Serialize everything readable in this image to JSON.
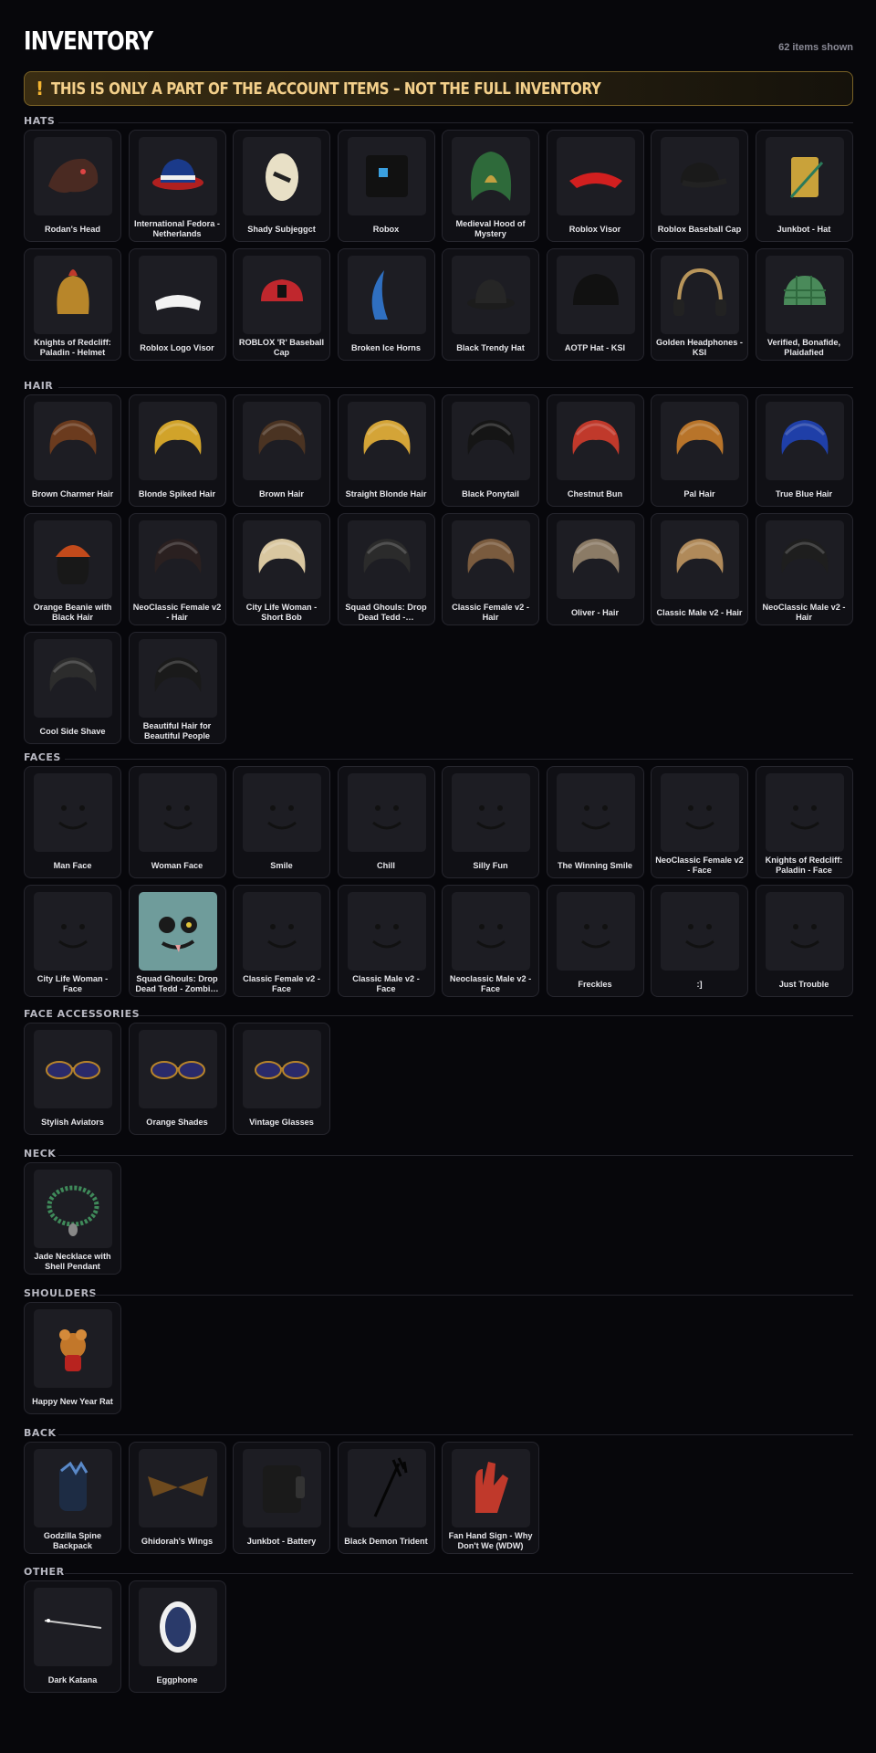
{
  "header": {
    "title": "INVENTORY",
    "count": "62 items shown"
  },
  "banner": {
    "icon": "warning-icon",
    "text": "THIS IS ONLY A PART OF THE ACCOUNT ITEMS – NOT THE FULL INVENTORY"
  },
  "sections": [
    {
      "label": "HATS",
      "items": [
        {
          "name": "Rodan's Head",
          "icon": "dragon-head-icon"
        },
        {
          "name": "International Fedora - Netherlands",
          "icon": "fedora-icon"
        },
        {
          "name": "Shady Subjeggct",
          "icon": "egg-icon"
        },
        {
          "name": "Robox",
          "icon": "robox-icon"
        },
        {
          "name": "Medieval Hood of Mystery",
          "icon": "hood-icon"
        },
        {
          "name": "Roblox Visor",
          "icon": "visor-icon"
        },
        {
          "name": "Roblox Baseball Cap",
          "icon": "cap-icon"
        },
        {
          "name": "Junkbot - Hat",
          "icon": "junkbot-hat-icon"
        },
        {
          "name": "Knights of Redcliff: Paladin - Helmet",
          "icon": "helmet-icon"
        },
        {
          "name": "Roblox Logo Visor",
          "icon": "logo-visor-icon"
        },
        {
          "name": "ROBLOX 'R' Baseball Cap",
          "icon": "r-cap-icon"
        },
        {
          "name": "Broken Ice Horns",
          "icon": "horns-icon"
        },
        {
          "name": "Black Trendy Hat",
          "icon": "trendy-hat-icon"
        },
        {
          "name": "AOTP Hat - KSI",
          "icon": "aotp-hat-icon"
        },
        {
          "name": "Golden Headphones - KSI",
          "icon": "headphones-icon"
        },
        {
          "name": "Verified, Bonafide, Plaidafied",
          "icon": "plaid-hat-icon"
        }
      ]
    },
    {
      "label": "HAIR",
      "items": [
        {
          "name": "Brown Charmer Hair",
          "icon": "hair-icon"
        },
        {
          "name": "Blonde Spiked Hair",
          "icon": "hair-icon"
        },
        {
          "name": "Brown Hair",
          "icon": "hair-icon"
        },
        {
          "name": "Straight Blonde Hair",
          "icon": "hair-icon"
        },
        {
          "name": "Black Ponytail",
          "icon": "hair-icon"
        },
        {
          "name": "Chestnut Bun",
          "icon": "hair-icon"
        },
        {
          "name": "Pal Hair",
          "icon": "hair-icon"
        },
        {
          "name": "True Blue Hair",
          "icon": "hair-icon"
        },
        {
          "name": "Orange Beanie with Black Hair",
          "icon": "beanie-icon"
        },
        {
          "name": "NeoClassic Female v2 - Hair",
          "icon": "hair-icon"
        },
        {
          "name": "City Life Woman - Short Bob",
          "icon": "hair-icon"
        },
        {
          "name": "Squad Ghouls: Drop Dead Tedd -…",
          "icon": "hair-icon"
        },
        {
          "name": "Classic Female v2 - Hair",
          "icon": "hair-icon"
        },
        {
          "name": "Oliver - Hair",
          "icon": "hair-icon"
        },
        {
          "name": "Classic Male v2 - Hair",
          "icon": "hair-icon"
        },
        {
          "name": "NeoClassic Male v2 - Hair",
          "icon": "hair-icon"
        },
        {
          "name": "Cool Side Shave",
          "icon": "hair-icon"
        },
        {
          "name": "Beautiful Hair for Beautiful People",
          "icon": "hair-icon"
        }
      ]
    },
    {
      "label": "FACES",
      "items": [
        {
          "name": "Man Face",
          "icon": "face-icon"
        },
        {
          "name": "Woman Face",
          "icon": "face-icon"
        },
        {
          "name": "Smile",
          "icon": "face-icon"
        },
        {
          "name": "Chill",
          "icon": "face-icon"
        },
        {
          "name": "Silly Fun",
          "icon": "face-icon"
        },
        {
          "name": "The Winning Smile",
          "icon": "face-icon"
        },
        {
          "name": "NeoClassic Female v2 - Face",
          "icon": "face-icon"
        },
        {
          "name": "Knights of Redcliff: Paladin - Face",
          "icon": "face-icon"
        },
        {
          "name": "City Life Woman - Face",
          "icon": "face-icon"
        },
        {
          "name": "Squad Ghouls: Drop Dead Tedd - Zombi…",
          "icon": "zombie-face-icon"
        },
        {
          "name": "Classic Female v2 - Face",
          "icon": "face-icon"
        },
        {
          "name": "Classic Male v2 - Face",
          "icon": "face-icon"
        },
        {
          "name": "Neoclassic Male v2 - Face",
          "icon": "face-icon"
        },
        {
          "name": "Freckles",
          "icon": "face-icon"
        },
        {
          "name": ":]",
          "icon": "face-icon"
        },
        {
          "name": "Just Trouble",
          "icon": "face-icon"
        }
      ]
    },
    {
      "label": "FACE ACCESSORIES",
      "items": [
        {
          "name": "Stylish Aviators",
          "icon": "glasses-icon"
        },
        {
          "name": "Orange Shades",
          "icon": "glasses-icon"
        },
        {
          "name": "Vintage Glasses",
          "icon": "glasses-icon"
        }
      ]
    },
    {
      "label": "NECK",
      "items": [
        {
          "name": "Jade Necklace with Shell Pendant",
          "icon": "necklace-icon"
        }
      ]
    },
    {
      "label": "SHOULDERS",
      "items": [
        {
          "name": "Happy New Year Rat",
          "icon": "rat-icon"
        }
      ]
    },
    {
      "label": "BACK",
      "items": [
        {
          "name": "Godzilla Spine Backpack",
          "icon": "backpack-icon"
        },
        {
          "name": "Ghidorah's Wings",
          "icon": "wings-icon"
        },
        {
          "name": "Junkbot - Battery",
          "icon": "battery-icon"
        },
        {
          "name": "Black Demon Trident",
          "icon": "trident-icon"
        },
        {
          "name": "Fan Hand Sign - Why Don't We (WDW)",
          "icon": "foam-hand-icon"
        }
      ]
    },
    {
      "label": "OTHER",
      "items": [
        {
          "name": "Dark Katana",
          "icon": "katana-icon"
        },
        {
          "name": "Eggphone",
          "icon": "eggphone-icon"
        }
      ]
    }
  ]
}
